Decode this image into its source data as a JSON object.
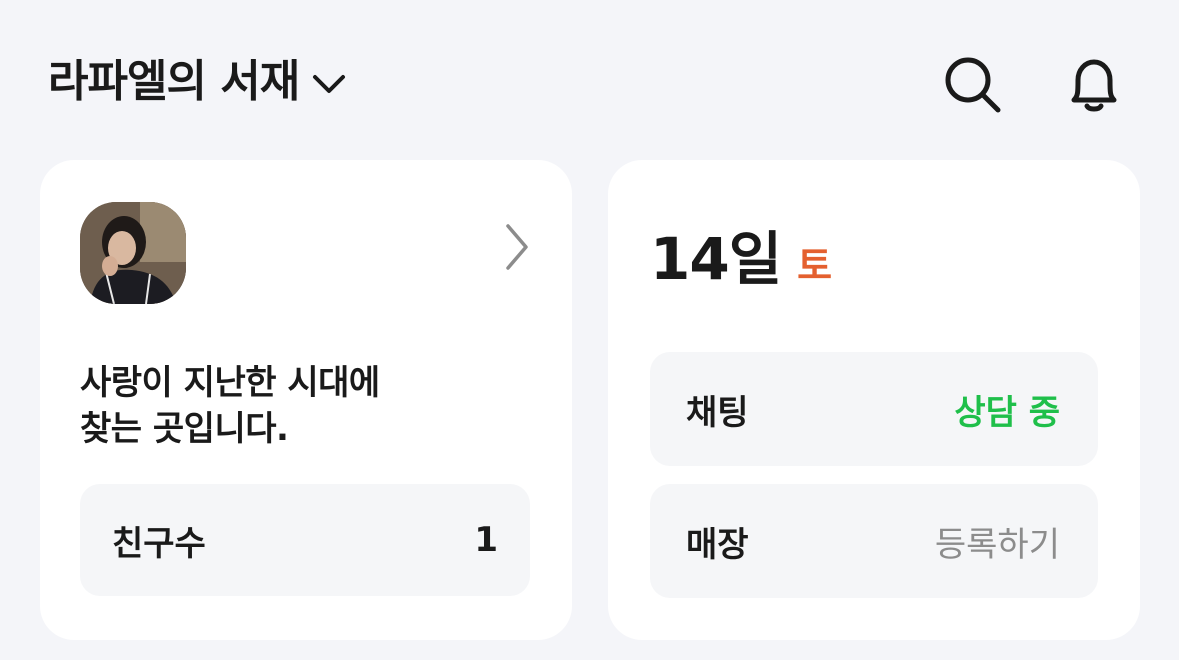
{
  "header": {
    "title": "라파엘의 서재",
    "icons": {
      "dropdown": "chevron-down-icon",
      "search": "search-icon",
      "notifications": "bell-icon"
    }
  },
  "profile_card": {
    "avatar": "profile-photo",
    "intro_line1": "사랑이 지난한 시대에",
    "intro_line2": "찾는 곳입니다.",
    "friends_label": "친구수",
    "friends_count": "1"
  },
  "status_card": {
    "date": "14일",
    "weekday": "토",
    "chat_label": "채팅",
    "chat_status": "상담 중",
    "store_label": "매장",
    "store_action": "등록하기"
  },
  "colors": {
    "background": "#f4f5f9",
    "card": "#ffffff",
    "row": "#f5f6f8",
    "weekday_accent": "#e4602f",
    "status_green": "#1fbf4a",
    "muted": "#8c8c8c"
  }
}
